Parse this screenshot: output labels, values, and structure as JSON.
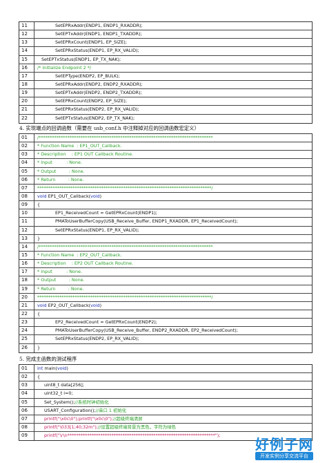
{
  "table1": {
    "rows": [
      {
        "n": "11",
        "t": "SetEPRxAddr(ENDP1, ENDP1_RXADDR);",
        "cls": "i1"
      },
      {
        "n": "12",
        "t": "SetEPTxAddr(ENDP1, ENDP1_TXADDR);",
        "cls": "i1"
      },
      {
        "n": "13",
        "t": "SetEPRxCount(ENDP1, EP_SIZE);",
        "cls": "i1"
      },
      {
        "n": "14",
        "t": "SetEPRxStatus(ENDP1, EP_RX_VALID);",
        "cls": "i1"
      },
      {
        "n": "15",
        "t": "SetEPTxStatus(ENDP1, EP_TX_NAK);",
        "cls": "i3"
      },
      {
        "n": "16",
        "t": "/* Initialize Endpoint 2 */",
        "cls": "c"
      },
      {
        "n": "17",
        "t": "SetEPType(ENDP2, EP_BULK);",
        "cls": "i1"
      },
      {
        "n": "18",
        "t": "SetEPRxAddr(ENDP2, ENDP2_RXADDR);",
        "cls": "i1"
      },
      {
        "n": "19",
        "t": "SetEPTxAddr(ENDP2, ENDP2_TXADDR);",
        "cls": "i1"
      },
      {
        "n": "20",
        "t": "SetEPRxCount(ENDP2, EP_SIZE);",
        "cls": "i1"
      },
      {
        "n": "21",
        "t": "SetEPRxStatus(ENDP2, EP_RX_VALID);",
        "cls": "i1"
      },
      {
        "n": "22",
        "t": "SetEPTxStatus(ENDP2, EP_TX_NAK);",
        "cls": "i1"
      }
    ]
  },
  "caption4": "4.  实现端点的回调函数（需要在 usb_conf.h 中注释掉对应的回调函数宏定义）",
  "table2": {
    "rows": [
      {
        "n": "01",
        "t": "/*******************************************************************************",
        "cls": "c"
      },
      {
        "n": "02",
        "t": "* Function Name  : EP1_OUT_Callback.",
        "cls": "c"
      },
      {
        "n": "03",
        "t": "* Description    : EP1 OUT Callback Routine.",
        "cls": "c"
      },
      {
        "n": "04",
        "t": "* Input          : None.",
        "cls": "c"
      },
      {
        "n": "05",
        "t": "* Output         : None.",
        "cls": "c"
      },
      {
        "n": "06",
        "t": "* Return         : None.",
        "cls": "c"
      },
      {
        "n": "07",
        "t": "*******************************************************************************/",
        "cls": "c"
      },
      {
        "n": "08",
        "t": "void EP1_OUT_Callback(void)",
        "cls": "fn"
      },
      {
        "n": "09",
        "t": "{",
        "cls": ""
      },
      {
        "n": "10",
        "t": "EP1_ReceivedCount = GetEPRxCount(ENDP1);",
        "cls": "i1"
      },
      {
        "n": "11",
        "t": "PMAToUserBufferCopy(USB_Receive_Buffer, ENDP1_RXADDR, EP1_ReceivedCount);",
        "cls": "i1"
      },
      {
        "n": "12",
        "t": "SetEPRxStatus(ENDP1, EP_RX_VALID);",
        "cls": "i1"
      },
      {
        "n": "13",
        "t": "}",
        "cls": ""
      },
      {
        "n": "14",
        "t": "/*******************************************************************************",
        "cls": "c"
      },
      {
        "n": "15",
        "t": "* Function Name  : EP2_OUT_Callback.",
        "cls": "c"
      },
      {
        "n": "16",
        "t": "* Description    : EP2 OUT Callback Routine.",
        "cls": "c"
      },
      {
        "n": "17",
        "t": "* Input          : None.",
        "cls": "c"
      },
      {
        "n": "18",
        "t": "* Output         : None.",
        "cls": "c"
      },
      {
        "n": "19",
        "t": "* Return         : None.",
        "cls": "c"
      },
      {
        "n": "20",
        "t": "*******************************************************************************/",
        "cls": "c"
      },
      {
        "n": "21",
        "t": "void EP2_OUT_Callback(void)",
        "cls": "fn"
      },
      {
        "n": "22",
        "t": "{",
        "cls": ""
      },
      {
        "n": "23",
        "t": "EP2_ReceivedCount = GetEPRxCount(ENDP2);",
        "cls": "i1"
      },
      {
        "n": "24",
        "t": "PMAToUserBufferCopy(USB_Receive_Buffer, ENDP2_RXADDR, EP2_ReceivedCount);",
        "cls": "i1"
      },
      {
        "n": "25",
        "t": "SetEPRxStatus(ENDP2, EP_RX_VALID);",
        "cls": "i1"
      },
      {
        "n": "26",
        "t": "}",
        "cls": ""
      }
    ]
  },
  "caption5": "5.  完成主函数的测试程序",
  "table3": {
    "rows": [
      {
        "n": "01",
        "t": "int main(void)",
        "cls": "main"
      },
      {
        "n": "02",
        "t": "{",
        "cls": ""
      },
      {
        "n": "03",
        "t": "uint8_t data[256];",
        "cls": "i2"
      },
      {
        "n": "04",
        "t": "uint32_t i=0;",
        "cls": "i2"
      },
      {
        "n": "05",
        "t": "Set_System();",
        "cmt": "//系统时钟初始化",
        "cls": "i2"
      },
      {
        "n": "06",
        "t": "USART_Configuration();",
        "cmt": "//串口 1 初始化",
        "cls": "i2"
      },
      {
        "n": "07",
        "t": "printf(\"\\x0c\\0\");printf(\"\\x0c\\0\");",
        "cmt": "//超级终端清屏",
        "cls": "i2 pf"
      },
      {
        "n": "08",
        "t": "printf(\"\\033[1;40;32m\");",
        "cmt": "//设置超级终端背景为黑色，字符为绿色",
        "cls": "i2 pf"
      },
      {
        "n": "09",
        "t": "printf(\"\\r\\n*******************************************************************\");",
        "cls": "i2 pf"
      }
    ]
  },
  "watermark": {
    "title": "好例子网",
    "sub": "开发实例分享交流平台"
  }
}
